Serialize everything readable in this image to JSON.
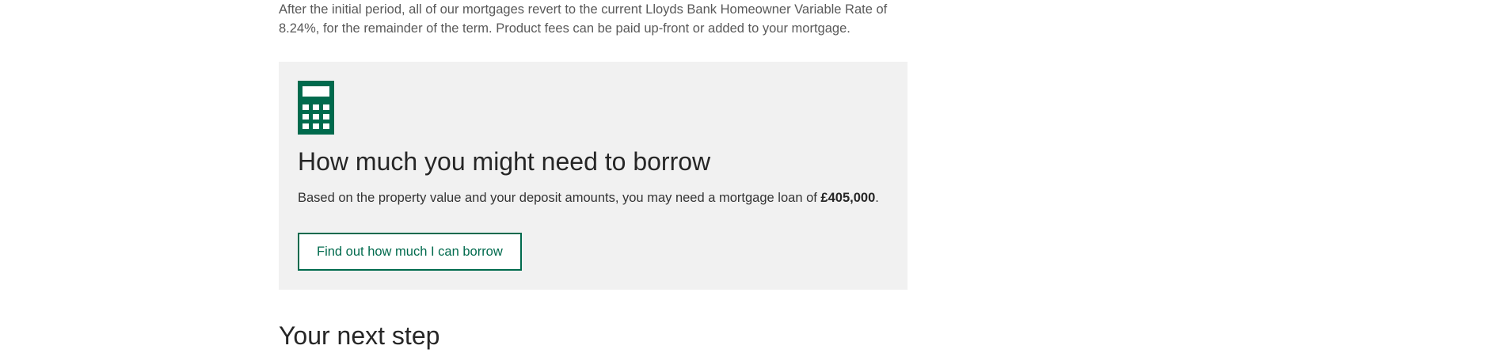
{
  "intro": {
    "text": "After the initial period, all of our mortgages revert to the current Lloyds Bank Homeowner Variable Rate of 8.24%, for the remainder of the term. Product fees can be paid up-front or added to your mortgage."
  },
  "borrow_panel": {
    "icon": "calculator-icon",
    "title": "How much you might need to borrow",
    "text_before": "Based on the property value and your deposit amounts, you may need a mortgage loan of ",
    "loan_amount": "£405,000",
    "text_after": ".",
    "button_label": "Find out how much I can borrow",
    "accent_color": "#006a4d",
    "background_color": "#f1f1f1"
  },
  "next_step": {
    "title": "Your next step"
  }
}
